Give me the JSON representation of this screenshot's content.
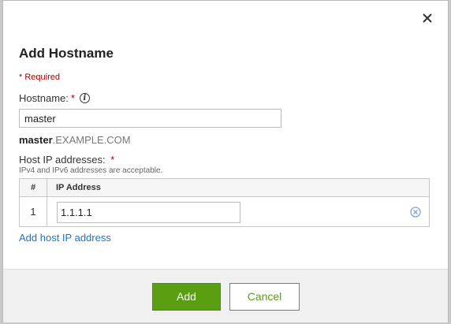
{
  "dialog": {
    "title": "Add Hostname",
    "close_icon": "close-icon"
  },
  "form": {
    "required_note": "* Required",
    "hostname_label": "Hostname:",
    "required_marker": "*",
    "info_icon": "info-icon",
    "hostname_value": "master",
    "fqdn_host": "master",
    "fqdn_domain": ".EXAMPLE.COM",
    "ip_label": "Host IP addresses:",
    "ip_help": "IPv4 and IPv6 addresses are acceptable.",
    "table": {
      "headers": [
        "#",
        "IP Address"
      ],
      "rows": [
        {
          "num": "1",
          "ip": "1.1.1.1"
        }
      ]
    },
    "remove_icon": "remove-circle-icon",
    "add_ip_link": "Add host IP address"
  },
  "footer": {
    "add_label": "Add",
    "cancel_label": "Cancel"
  },
  "colors": {
    "primary_green": "#5a9e12",
    "link_blue": "#1f75c4",
    "required_red": "#a30000"
  }
}
